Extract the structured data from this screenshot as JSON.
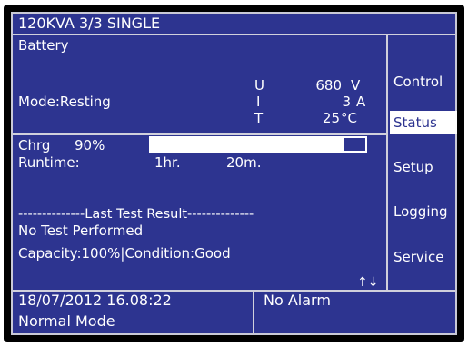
{
  "header": {
    "title": "120KVA   3/3 SINGLE"
  },
  "section_title": "Battery",
  "mode": "Mode:Resting",
  "measurements": [
    {
      "symbol": "U",
      "value": "680",
      "unit": "V"
    },
    {
      "symbol": "I",
      "value": "3",
      "unit": "A"
    },
    {
      "symbol": "T",
      "value": "25",
      "unit": "°C"
    }
  ],
  "charge": {
    "label": "Chrg",
    "text": "90%",
    "fraction": 0.9
  },
  "runtime": {
    "label": "Runtime:",
    "hours": "1hr.",
    "minutes": "20m."
  },
  "last_test": {
    "header": "--------------Last Test Result--------------",
    "result": "No Test Performed",
    "capacity_condition": "Capacity:100%|Condition:Good"
  },
  "scroll_arrows": "↑↓",
  "menu": [
    {
      "label": "Control",
      "active": false
    },
    {
      "label": "Status",
      "active": true
    },
    {
      "label": "Setup",
      "active": false
    },
    {
      "label": "Logging",
      "active": false
    },
    {
      "label": "Service",
      "active": false
    }
  ],
  "footer": {
    "datetime": "18/07/2012  16.08:22",
    "mode": "Normal Mode",
    "alarm": "No Alarm"
  },
  "colors": {
    "screen": "#2d3490",
    "text": "#ffffff",
    "frame": "#000000"
  }
}
